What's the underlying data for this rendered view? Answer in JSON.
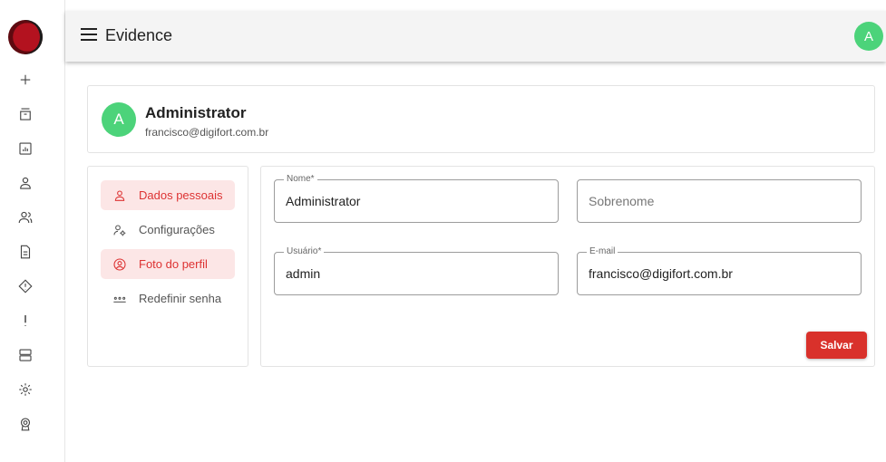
{
  "app": {
    "title": "Evidence",
    "user_initial": "A"
  },
  "rail": {
    "icons": [
      "plus-icon",
      "archive-icon",
      "chart-icon",
      "user-icon",
      "users-icon",
      "document-icon",
      "warning-diamond-icon",
      "alert-icon",
      "server-icon",
      "settings-icon",
      "badge-icon"
    ]
  },
  "profile": {
    "initial": "A",
    "name": "Administrator",
    "email": "francisco@digifort.com.br"
  },
  "menu": {
    "items": [
      {
        "label": "Dados pessoais",
        "icon": "user-icon",
        "active": true
      },
      {
        "label": "Configurações",
        "icon": "user-settings-icon",
        "active": false
      },
      {
        "label": "Foto do perfil",
        "icon": "profile-photo-icon",
        "active": true
      },
      {
        "label": "Redefinir senha",
        "icon": "password-dots-icon",
        "active": false
      }
    ]
  },
  "form": {
    "nome": {
      "label": "Nome*",
      "value": "Administrator"
    },
    "sobrenome": {
      "placeholder": "Sobrenome",
      "value": ""
    },
    "usuario": {
      "label": "Usuário*",
      "value": "admin"
    },
    "email": {
      "label": "E-mail",
      "value": "francisco@digifort.com.br"
    },
    "save_label": "Salvar"
  },
  "colors": {
    "accent": "#d9312b",
    "avatar": "#4cd37a",
    "active_bg": "#fce6e6"
  }
}
